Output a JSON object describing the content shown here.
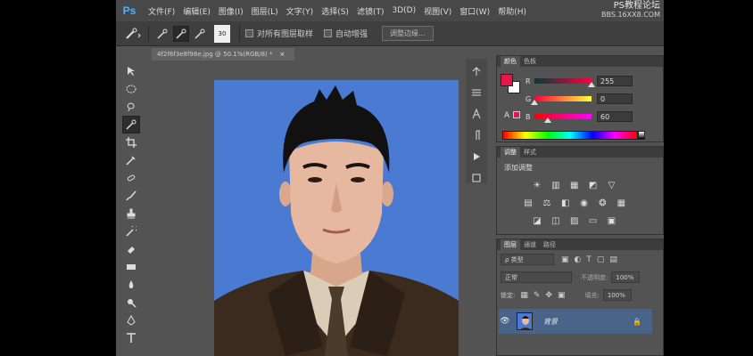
{
  "menubar": {
    "logo": "Ps",
    "items": [
      "文件(F)",
      "编辑(E)",
      "图像(I)",
      "图层(L)",
      "文字(Y)",
      "选择(S)",
      "滤镜(T)",
      "3D(D)",
      "视图(V)",
      "窗口(W)",
      "帮助(H)"
    ]
  },
  "watermark": {
    "line1": "PS教程论坛",
    "line2": "BBS.16XX8.COM"
  },
  "options": {
    "size_value": "30",
    "sample_all_layers": "对所有图层取样",
    "auto_enhance": "自动增强",
    "refine_edge": "调整边缘..."
  },
  "document": {
    "tab_title": "4f2f6f3e8f98e.jpg @ 50.1%(RGB/8) *"
  },
  "color_panel": {
    "tabs": [
      "颜色",
      "色板"
    ],
    "channels": [
      {
        "label": "R",
        "value": "255",
        "level": 1.0
      },
      {
        "label": "G",
        "value": "0",
        "level": 0.0
      },
      {
        "label": "B",
        "value": "60",
        "level": 0.235
      }
    ],
    "foreground": "#e8174a",
    "background": "#ffffff"
  },
  "adjust_panel": {
    "tabs": [
      "调整",
      "样式"
    ],
    "title": "添加调整"
  },
  "layers_panel": {
    "tabs": [
      "图层",
      "通道",
      "路径"
    ],
    "filter_label": "ρ 类型",
    "blend_mode": "正常",
    "opacity_label": "不透明度:",
    "opacity_value": "100%",
    "lock_label": "锁定:",
    "fill_label": "填充:",
    "fill_value": "100%",
    "layer_name": "背景",
    "lock_icon": "🔒"
  },
  "colors": {
    "app_bg": "#535353",
    "photo_bg": "#4a7ad1",
    "selected_layer": "#4a6389"
  }
}
